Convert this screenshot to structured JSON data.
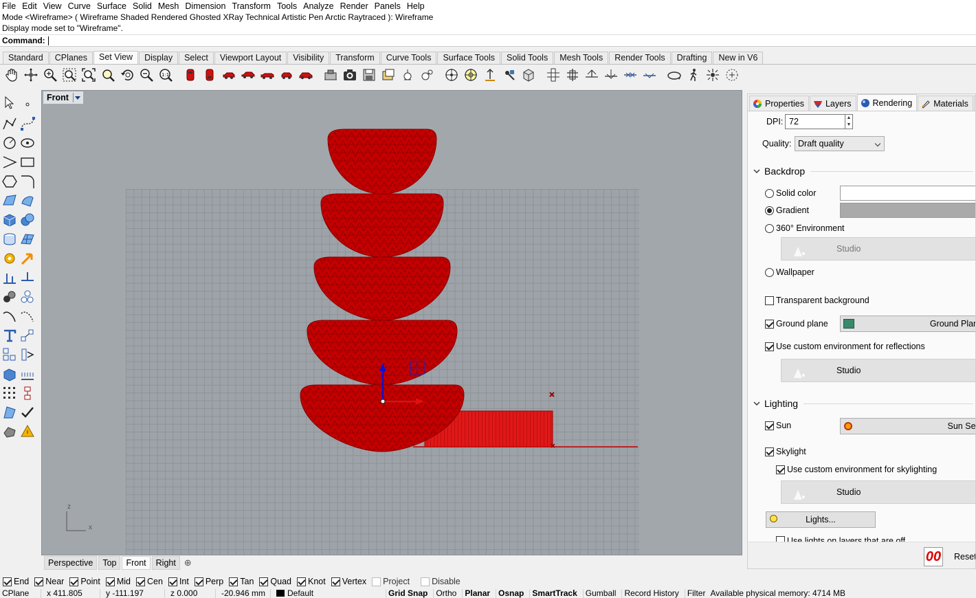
{
  "menu": [
    "File",
    "Edit",
    "View",
    "Curve",
    "Surface",
    "Solid",
    "Mesh",
    "Dimension",
    "Transform",
    "Tools",
    "Analyze",
    "Render",
    "Panels",
    "Help"
  ],
  "command_history": [
    "Mode <Wireframe> ( Wireframe  Shaded  Rendered  Ghosted  XRay  Technical  Artistic  Pen  Arctic  Raytraced ): Wireframe",
    "Display mode set to \"Wireframe\"."
  ],
  "command_prompt": "Command:",
  "toolbar_tabs": [
    "Standard",
    "CPlanes",
    "Set View",
    "Display",
    "Select",
    "Viewport Layout",
    "Visibility",
    "Transform",
    "Curve Tools",
    "Surface Tools",
    "Solid Tools",
    "Mesh Tools",
    "Render Tools",
    "Drafting",
    "New in V6"
  ],
  "active_toolbar_tab": "Set View",
  "viewport": {
    "title": "Front",
    "axis_z": "z",
    "axis_x": "x"
  },
  "viewport_tabs": [
    "Perspective",
    "Top",
    "Front",
    "Right"
  ],
  "active_viewport_tab": "Front",
  "osnaps": [
    {
      "label": "End",
      "checked": true
    },
    {
      "label": "Near",
      "checked": true
    },
    {
      "label": "Point",
      "checked": true
    },
    {
      "label": "Mid",
      "checked": true
    },
    {
      "label": "Cen",
      "checked": true
    },
    {
      "label": "Int",
      "checked": true
    },
    {
      "label": "Perp",
      "checked": true
    },
    {
      "label": "Tan",
      "checked": true
    },
    {
      "label": "Quad",
      "checked": true
    },
    {
      "label": "Knot",
      "checked": true
    },
    {
      "label": "Vertex",
      "checked": true
    },
    {
      "label": "Project",
      "checked": false
    },
    {
      "label": "Disable",
      "checked": false
    }
  ],
  "status": {
    "cplane": "CPlane",
    "x": "x 411.805",
    "y": "y -111.197",
    "z": "z 0.000",
    "distance": "-20.946 mm",
    "layer": "Default",
    "grid_snap": "Grid Snap",
    "ortho": "Ortho",
    "planar": "Planar",
    "osnap": "Osnap",
    "smarttrack": "SmartTrack",
    "gumball": "Gumball",
    "record_history": "Record History",
    "filter": "Filter",
    "memory": "Available physical memory: 4714 MB"
  },
  "panel": {
    "tabs": [
      "Properties",
      "Layers",
      "Rendering",
      "Materials"
    ],
    "active_tab": "Rendering",
    "dpi_label": "DPI:",
    "dpi_value": "72",
    "quality_label": "Quality:",
    "quality_value": "Draft quality",
    "backdrop": {
      "title": "Backdrop",
      "solid_color": "Solid color",
      "gradient": "Gradient",
      "environment_360": "360° Environment",
      "environment_name": "Studio",
      "wallpaper": "Wallpaper",
      "selected": "Gradient",
      "gradient_color": "#aaaaaa"
    },
    "transparent_background": {
      "label": "Transparent background",
      "checked": false
    },
    "ground_plane": {
      "label": "Ground plane",
      "checked": true,
      "button": "Ground Plan"
    },
    "custom_reflections": {
      "label": "Use custom environment for reflections",
      "checked": true,
      "environment": "Studio"
    },
    "lighting": {
      "title": "Lighting",
      "sun": {
        "label": "Sun",
        "checked": true,
        "button": "Sun Set"
      },
      "skylight": {
        "label": "Skylight",
        "checked": true
      },
      "custom_skylighting": {
        "label": "Use custom environment for skylighting",
        "checked": true,
        "environment": "Studio"
      },
      "lights_button": "Lights...",
      "lights_off_layers": "Use lights on layers that are off"
    },
    "reset_button": "Reset"
  },
  "colors": {
    "model_red": "#c40000",
    "viewport_bg": "#a2a7ab"
  }
}
